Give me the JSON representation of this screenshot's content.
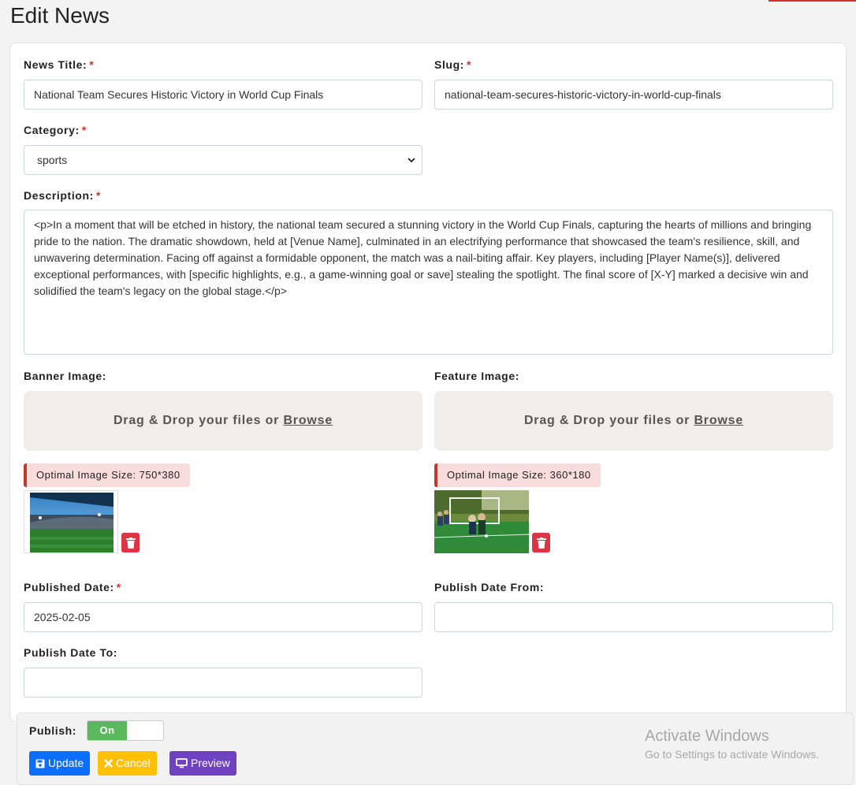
{
  "page": {
    "title": "Edit News"
  },
  "form": {
    "news_title": {
      "label": "News Title:",
      "required": "*",
      "value": "National Team Secures Historic Victory in World Cup Finals"
    },
    "slug": {
      "label": "Slug:",
      "required": "*",
      "value": "national-team-secures-historic-victory-in-world-cup-finals"
    },
    "category": {
      "label": "Category:",
      "required": "*",
      "value": "sports"
    },
    "description": {
      "label": "Description:",
      "required": "*",
      "value": "<p>In a moment that will be etched in history, the national team secured a stunning victory in the World Cup Finals, capturing the hearts of millions and bringing pride to the nation. The dramatic showdown, held at [Venue Name], culminated in an electrifying performance that showcased the team's resilience, skill, and unwavering determination. Facing off against a formidable opponent, the match was a nail-biting affair. Key players, including [Player Name(s)], delivered exceptional performances, with [specific highlights, e.g., a game-winning goal or save] stealing the spotlight. The final score of [X-Y] marked a decisive win and solidified the team's legacy on the global stage.</p>"
    },
    "banner_image": {
      "label": "Banner Image:",
      "drop_text": "Drag & Drop your files or",
      "browse": "Browse",
      "hint": "Optimal Image Size: 750*380"
    },
    "feature_image": {
      "label": "Feature Image:",
      "drop_text": "Drag & Drop your files or",
      "browse": "Browse",
      "hint": "Optimal Image Size: 360*180"
    },
    "published_date": {
      "label": "Published Date:",
      "required": "*",
      "value": "2025-02-05"
    },
    "publish_date_from": {
      "label": "Publish Date From:",
      "value": ""
    },
    "publish_date_to": {
      "label": "Publish Date To:",
      "value": ""
    }
  },
  "footer": {
    "publish_label": "Publish:",
    "toggle_on": "On",
    "update": "Update",
    "cancel": "Cancel",
    "preview": "Preview"
  },
  "watermark": {
    "title": "Activate Windows",
    "subtitle": "Go to Settings to activate Windows."
  },
  "colors": {
    "required": "#d32f2f",
    "update": "#0d6efd",
    "cancel": "#ffc107",
    "preview": "#6f42c1",
    "toggle_on": "#5cb85c",
    "delete": "#dc3545"
  }
}
